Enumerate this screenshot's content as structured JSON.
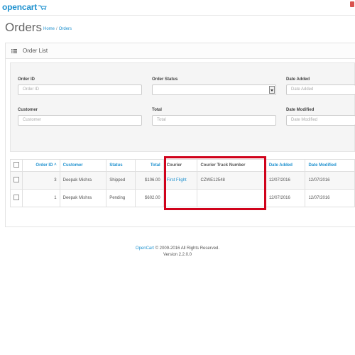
{
  "brand": {
    "name": "opencart"
  },
  "page": {
    "title": "Orders"
  },
  "breadcrumb": {
    "home": "Home",
    "separator": "/",
    "current": "Orders"
  },
  "panel": {
    "title": "Order List"
  },
  "filters": {
    "order_id": {
      "label": "Order ID",
      "placeholder": "Order ID"
    },
    "order_status": {
      "label": "Order Status",
      "value": ""
    },
    "date_added": {
      "label": "Date Added",
      "placeholder": "Date Added"
    },
    "customer": {
      "label": "Customer",
      "placeholder": "Customer"
    },
    "total": {
      "label": "Total",
      "placeholder": "Total"
    },
    "date_modified": {
      "label": "Date Modified",
      "placeholder": "Date Modified"
    }
  },
  "table": {
    "columns": {
      "order_id": "Order ID",
      "customer": "Customer",
      "status": "Status",
      "total": "Total",
      "courier": "Courier",
      "courier_track": "Courier Track Number",
      "date_added": "Date Added",
      "date_modified": "Date Modified"
    },
    "rows": [
      {
        "order_id": "3",
        "customer": "Deepak Mishra",
        "status": "Shipped",
        "total": "$106.00",
        "courier": "First Flight",
        "track": "CZWE12548",
        "date_added": "12/07/2016",
        "date_modified": "12/07/2016"
      },
      {
        "order_id": "1",
        "customer": "Deepak Mishra",
        "status": "Pending",
        "total": "$602.00",
        "courier": "",
        "track": "",
        "date_added": "12/07/2016",
        "date_modified": "12/07/2016"
      }
    ]
  },
  "footer": {
    "link": "OpenCart",
    "copyright": "© 2009-2016 All Rights Reserved.",
    "version": "Version 2.2.0.0"
  },
  "colors": {
    "accent": "#1e91cf",
    "highlight": "#d0021b"
  }
}
